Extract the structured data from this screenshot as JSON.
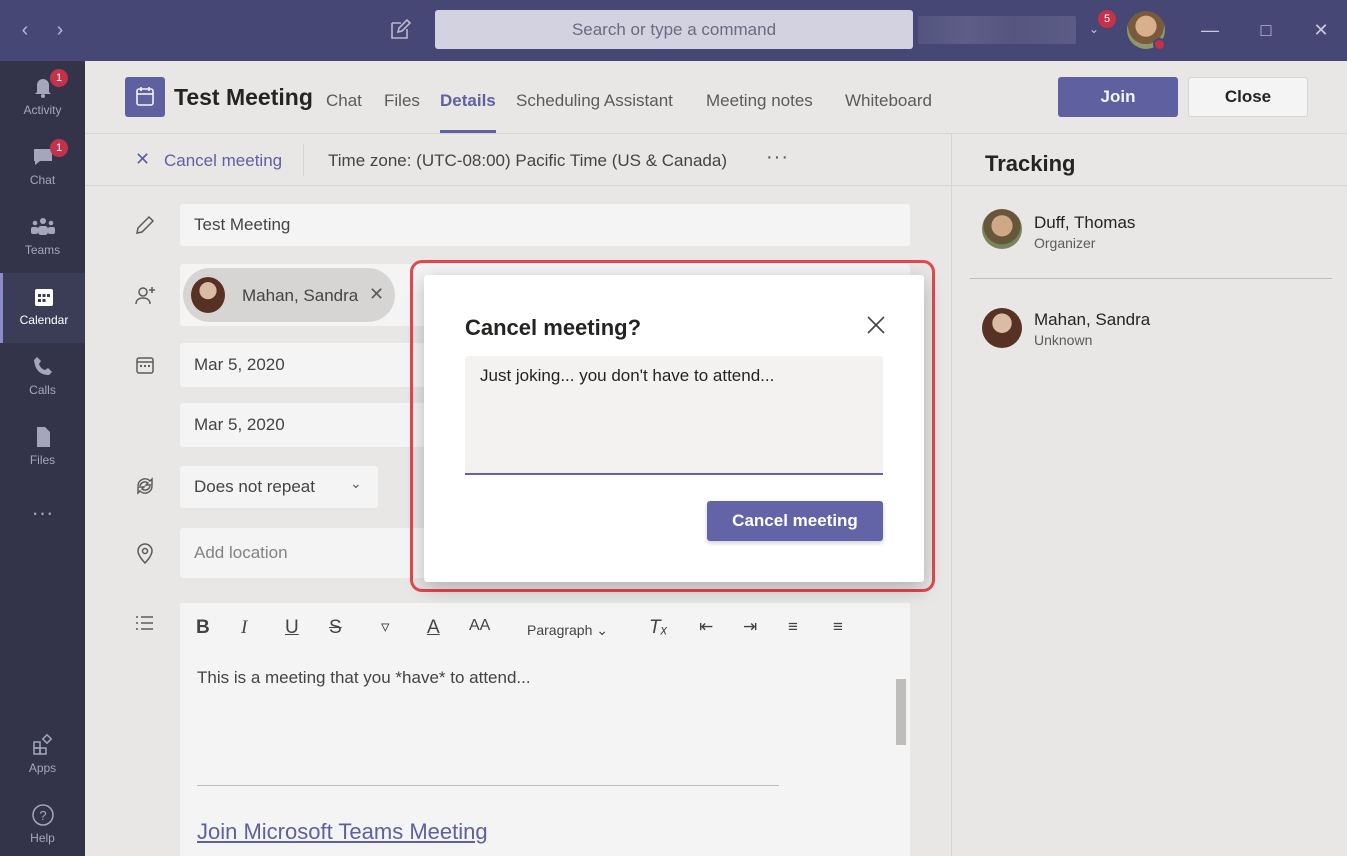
{
  "titlebar": {
    "search_placeholder": "Search or type a command",
    "notification_count": "5"
  },
  "rail": {
    "items": [
      {
        "label": "Activity",
        "badge": "1"
      },
      {
        "label": "Chat",
        "badge": "1"
      },
      {
        "label": "Teams"
      },
      {
        "label": "Calendar",
        "active": true
      },
      {
        "label": "Calls"
      },
      {
        "label": "Files"
      },
      {
        "label": "Apps"
      },
      {
        "label": "Help"
      }
    ],
    "more": "···"
  },
  "meeting": {
    "title": "Test Meeting",
    "tabs": [
      "Chat",
      "Files",
      "Details",
      "Scheduling Assistant",
      "Meeting notes",
      "Whiteboard"
    ],
    "active_tab": "Details",
    "join_label": "Join",
    "close_label": "Close"
  },
  "commandbar": {
    "cancel_label": "Cancel meeting",
    "timezone": "Time zone: (UTC-08:00) Pacific Time (US & Canada)",
    "more": "···"
  },
  "form": {
    "title_value": "Test Meeting",
    "attendee_name": "Mahan, Sandra",
    "start_date": "Mar 5, 2020",
    "end_date": "Mar 5, 2020",
    "repeat": "Does not repeat",
    "location_placeholder": "Add location",
    "editor": {
      "paragraph_label": "Paragraph",
      "body": "This is a meeting that you *have* to attend...",
      "link": "Join Microsoft Teams Meeting"
    }
  },
  "tracking": {
    "title": "Tracking",
    "attendees": [
      {
        "name": "Duff, Thomas",
        "role": "Organizer"
      },
      {
        "name": "Mahan, Sandra",
        "role": "Unknown"
      }
    ]
  },
  "dialog": {
    "title": "Cancel meeting?",
    "message_value": "Just joking... you don't have to attend...",
    "confirm_label": "Cancel meeting"
  },
  "colors": {
    "titlebar": "#464775",
    "rail": "#33344a",
    "accent": "#6264a7",
    "badge": "#c4314b",
    "highlight": "#e5474f"
  }
}
